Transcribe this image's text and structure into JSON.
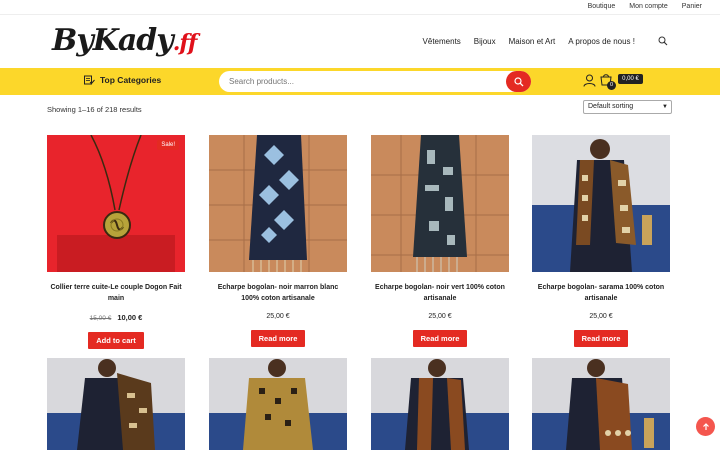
{
  "topbar": {
    "links": [
      "Boutique",
      "Mon compte",
      "Panier"
    ]
  },
  "header": {
    "logo_main": "ByKady",
    "logo_suffix": ".ff",
    "nav": [
      "Vêtements",
      "Bijoux",
      "Maison et Art",
      "A propos de nous !"
    ],
    "search_icon": "search-icon"
  },
  "catbar": {
    "top_categories": "Top Categories",
    "search_placeholder": "Search products...",
    "cart_count": "0",
    "cart_total": "0,00 €"
  },
  "shop": {
    "results": "Showing 1–16 of 218 results",
    "sorting": "Default sorting"
  },
  "products": [
    {
      "title": "Collier terre cuite-Le couple Dogon Fait main",
      "old_price": "15,00 €",
      "price": "10,00 €",
      "button": "Add to cart",
      "badge": "Sale!"
    },
    {
      "title": "Echarpe bogolan- noir marron blanc 100% coton artisanale",
      "price": "25,00 €",
      "button": "Read more"
    },
    {
      "title": "Echarpe bogolan- noir vert 100% coton artisanale",
      "price": "25,00 €",
      "button": "Read more"
    },
    {
      "title": "Echarpe bogolan- sarama 100% coton artisanale",
      "price": "25,00 €",
      "button": "Read more"
    }
  ],
  "colors": {
    "accent": "#e42a22",
    "bar": "#fcd72a"
  }
}
